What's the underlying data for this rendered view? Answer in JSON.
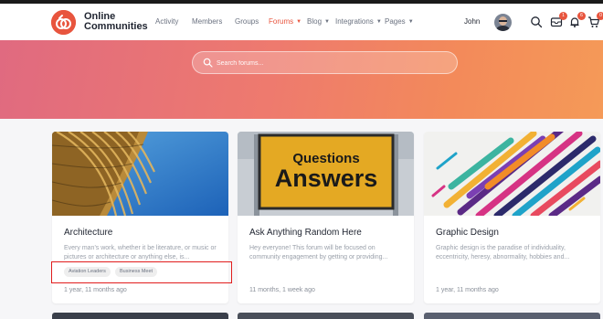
{
  "brand": {
    "line1": "Online",
    "line2": "Communities"
  },
  "nav": [
    {
      "label": "Activity",
      "caret": false,
      "active": false
    },
    {
      "label": "Members",
      "caret": false,
      "active": false
    },
    {
      "label": "Groups",
      "caret": false,
      "active": false
    },
    {
      "label": "Forums",
      "caret": true,
      "active": true
    },
    {
      "label": "Blog",
      "caret": true,
      "active": false
    },
    {
      "label": "Integrations",
      "caret": true,
      "active": false
    },
    {
      "label": "Pages",
      "caret": true,
      "active": false
    }
  ],
  "user": {
    "name": "John"
  },
  "header_icons": {
    "messages_badge": "1",
    "notifications_badge": "6",
    "cart_badge": "0"
  },
  "search": {
    "placeholder": "Search forums..."
  },
  "cards": [
    {
      "title": "Architecture",
      "description": "Every man's work, whether it be literature, or music or pictures or architecture or anything else, is...",
      "tags": [
        "Aviation Leaders",
        "Business Meet"
      ],
      "meta": "1 year, 11 months ago"
    },
    {
      "title": "Ask Anything Random Here",
      "description": "Hey everyone! This forum will be focused on community engagement by getting or providing...",
      "sign_line1": "Questions",
      "sign_line2": "Answers",
      "meta": "11 months, 1 week ago"
    },
    {
      "title": "Graphic Design",
      "description": "Graphic design is the paradise of individuality, eccentricity, heresy, abnormality, hobbies and...",
      "meta": "1 year, 11 months ago"
    }
  ],
  "colors": {
    "accent": "#e8553e",
    "highlight": "#e11d1d"
  }
}
